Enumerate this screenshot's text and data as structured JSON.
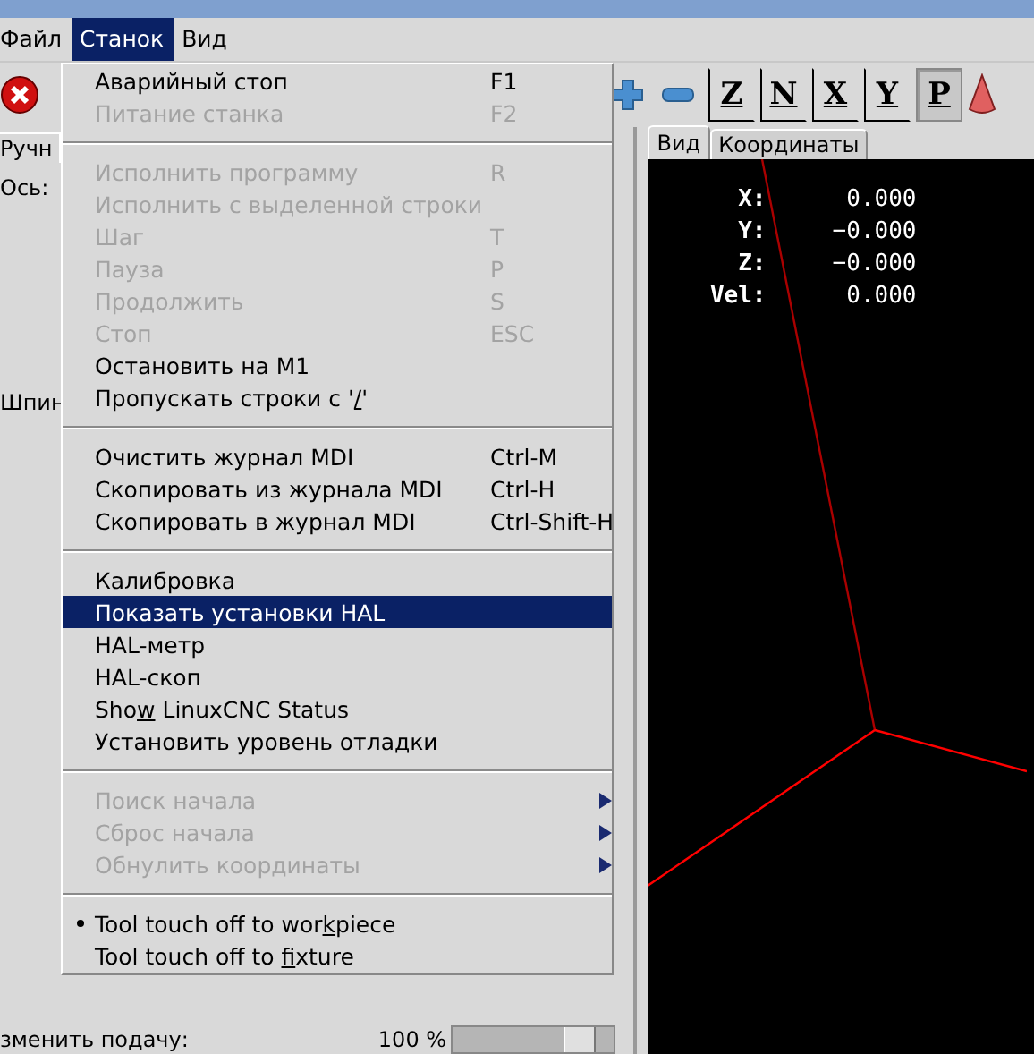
{
  "menu_bar": [
    {
      "label": "Файл",
      "selected": false
    },
    {
      "label": "Станок",
      "selected": true
    },
    {
      "label": "Вид",
      "selected": false
    }
  ],
  "toolbar": {
    "view_buttons": [
      {
        "label": "Z",
        "selected": false
      },
      {
        "label": "N",
        "selected": false
      },
      {
        "label": "X",
        "selected": false
      },
      {
        "label": "Y",
        "selected": false
      },
      {
        "label": "P",
        "selected": true
      }
    ]
  },
  "left_panel": {
    "tab": "Ручн",
    "axis_label": "Ось:",
    "spindle_label": "Шпин",
    "feed_label": "зменить подачу:",
    "feed_value": "100 %",
    "feed_slider": {
      "level": 0.85
    }
  },
  "notebook": {
    "tabs": [
      {
        "label": "Вид",
        "selected": true
      },
      {
        "label": "Координаты",
        "selected": false
      }
    ],
    "dro": [
      {
        "axis": "X:",
        "value": "0.000"
      },
      {
        "axis": "Y:",
        "value": "−0.000"
      },
      {
        "axis": "Z:",
        "value": "−0.000"
      },
      {
        "axis": "Vel:",
        "value": "0.000"
      }
    ]
  },
  "dropdown": {
    "sections": [
      [
        {
          "kind": "command",
          "label": "Аварийный стоп",
          "shortcut": "F1",
          "disabled": false,
          "selected": false
        },
        {
          "kind": "command",
          "label": "Питание станка",
          "shortcut": "F2",
          "disabled": true,
          "selected": false
        }
      ],
      [
        {
          "kind": "command",
          "label": "Исполнить программу",
          "shortcut": "R",
          "disabled": true,
          "selected": false
        },
        {
          "kind": "command",
          "label": "Исполнить с выделенной строки",
          "disabled": true,
          "selected": false
        },
        {
          "kind": "command",
          "label": "Шаг",
          "shortcut": "T",
          "disabled": true,
          "selected": false
        },
        {
          "kind": "command",
          "label": "Пауза",
          "shortcut": "P",
          "disabled": true,
          "selected": false
        },
        {
          "kind": "command",
          "label": "Продолжить",
          "shortcut": "S",
          "disabled": true,
          "selected": false
        },
        {
          "kind": "command",
          "label": "Стоп",
          "shortcut": "ESC",
          "disabled": true,
          "selected": false
        },
        {
          "kind": "command",
          "label": "Остановить на M1",
          "disabled": false,
          "selected": false
        },
        {
          "kind": "command",
          "label": "Пропускать строки с '",
          "mnemonic": "/",
          "label_end": "'",
          "disabled": false,
          "selected": false
        }
      ],
      [
        {
          "kind": "command",
          "label": "Очистить журнал MDI",
          "shortcut": "Ctrl-M",
          "disabled": false,
          "selected": false
        },
        {
          "kind": "command",
          "label": "Скопировать из журнала MDI",
          "shortcut": "Ctrl-H",
          "disabled": false,
          "selected": false
        },
        {
          "kind": "command",
          "label": "Скопировать в журнал MDI",
          "shortcut": "Ctrl-Shift-H",
          "disabled": false,
          "selected": false
        }
      ],
      [
        {
          "kind": "command",
          "label": "Калибровка",
          "disabled": false,
          "selected": false
        },
        {
          "kind": "command",
          "label": "Показать установки HAL",
          "disabled": false,
          "selected": true
        },
        {
          "kind": "command",
          "label": "HAL-метр",
          "disabled": false,
          "selected": false
        },
        {
          "kind": "command",
          "label": "HAL-скоп",
          "disabled": false,
          "selected": false
        },
        {
          "kind": "command",
          "label": "Sho",
          "mnemonic": "w",
          "label_end": " LinuxCNC Status",
          "disabled": false,
          "selected": false
        },
        {
          "kind": "command",
          "label": "Установить уровень отладки",
          "disabled": false,
          "selected": false
        }
      ],
      [
        {
          "kind": "submenu",
          "label": "Поиск начала",
          "disabled": true,
          "selected": false
        },
        {
          "kind": "submenu",
          "label": "Сброс начала",
          "disabled": true,
          "selected": false
        },
        {
          "kind": "submenu",
          "label": "Обнулить координаты",
          "disabled": true,
          "selected": false
        }
      ],
      [
        {
          "kind": "radio",
          "label": "Tool touch off to wor",
          "mnemonic": "k",
          "label_end": "piece",
          "checked": true,
          "disabled": false,
          "selected": false
        },
        {
          "kind": "radio",
          "label": "Tool touch off to ",
          "mnemonic": "f",
          "label_end": "ixture",
          "checked": false,
          "disabled": false,
          "selected": false
        }
      ]
    ]
  }
}
